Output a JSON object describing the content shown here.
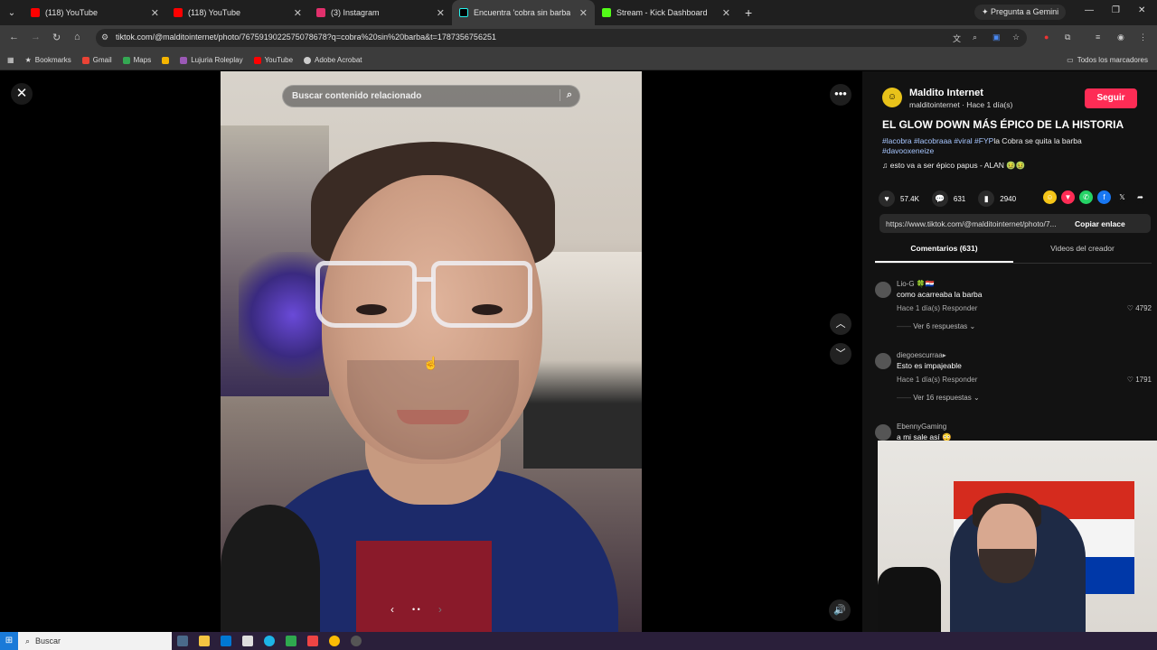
{
  "tabs": [
    {
      "label": "(118) YouTube",
      "color": "#ff0000",
      "active": false
    },
    {
      "label": "(118) YouTube",
      "color": "#ff0000",
      "active": false
    },
    {
      "label": "(3) Instagram",
      "color": "#e1306c",
      "active": false
    },
    {
      "label": "Encuentra 'cobra sin barba",
      "color": "#000000",
      "active": true
    },
    {
      "label": "Stream - Kick Dashboard",
      "color": "#53fc18",
      "active": false
    }
  ],
  "gemini_label": "Pregunta a Gemini",
  "url": "tiktok.com/@malditointernet/photo/7675919022575078678?q=cobra%20sin%20barba&t=1787356756251",
  "bookmarks": [
    "Bookmarks",
    "Gmail",
    "Maps",
    "Lujuria Roleplay",
    "YouTube",
    "Adobe Acrobat"
  ],
  "bookmark_colors": [
    "#aaaaaa",
    "#ea4335",
    "#34a853",
    "#f4b400",
    "#9b59b6",
    "#ff0000",
    "#cccccc"
  ],
  "all_bookmarks": "Todos los marcadores",
  "viewer": {
    "search_placeholder": "Buscar contenido relacionado",
    "pager_dots": "• •"
  },
  "panel": {
    "author_name": "Maldito Internet",
    "author_sub": "malditointernet · Hace 1 día(s)",
    "follow_label": "Seguir",
    "title": "EL GLOW DOWN MÁS ÉPICO DE LA HISTORIA",
    "hashtags": "#lacobra #lacobraaa #viral #FYP",
    "caption_rest": "la Cobra se quita la barba",
    "hashtag2": "#davooxeneize",
    "sound": "esto va a ser épico papus - ALAN 🤢🤢",
    "likes": "57.4K",
    "comments_count": "631",
    "saves": "2940",
    "link": "https://www.tiktok.com/@malditointernet/photo/7...",
    "copy_label": "Copiar enlace",
    "tab_comments": "Comentarios (631)",
    "tab_videos": "Videos del creador"
  },
  "comments": [
    {
      "user": "Lio-G 🍀🇵🇾",
      "text": "como acarreaba la barba",
      "meta": "Hace 1 día(s)   Responder",
      "likes": "4792",
      "replies": "Ver 6 respuestas"
    },
    {
      "user": "diegoescurraa▸",
      "text": "Esto es impajeable",
      "meta": "Hace 1 día(s)   Responder",
      "likes": "1791",
      "replies": "Ver 16 respuestas"
    },
    {
      "user": "EbennyGaming",
      "text": "a mi sale así 😳",
      "meta": "",
      "likes": "",
      "replies": ""
    }
  ],
  "taskbar": {
    "search": "Buscar"
  }
}
